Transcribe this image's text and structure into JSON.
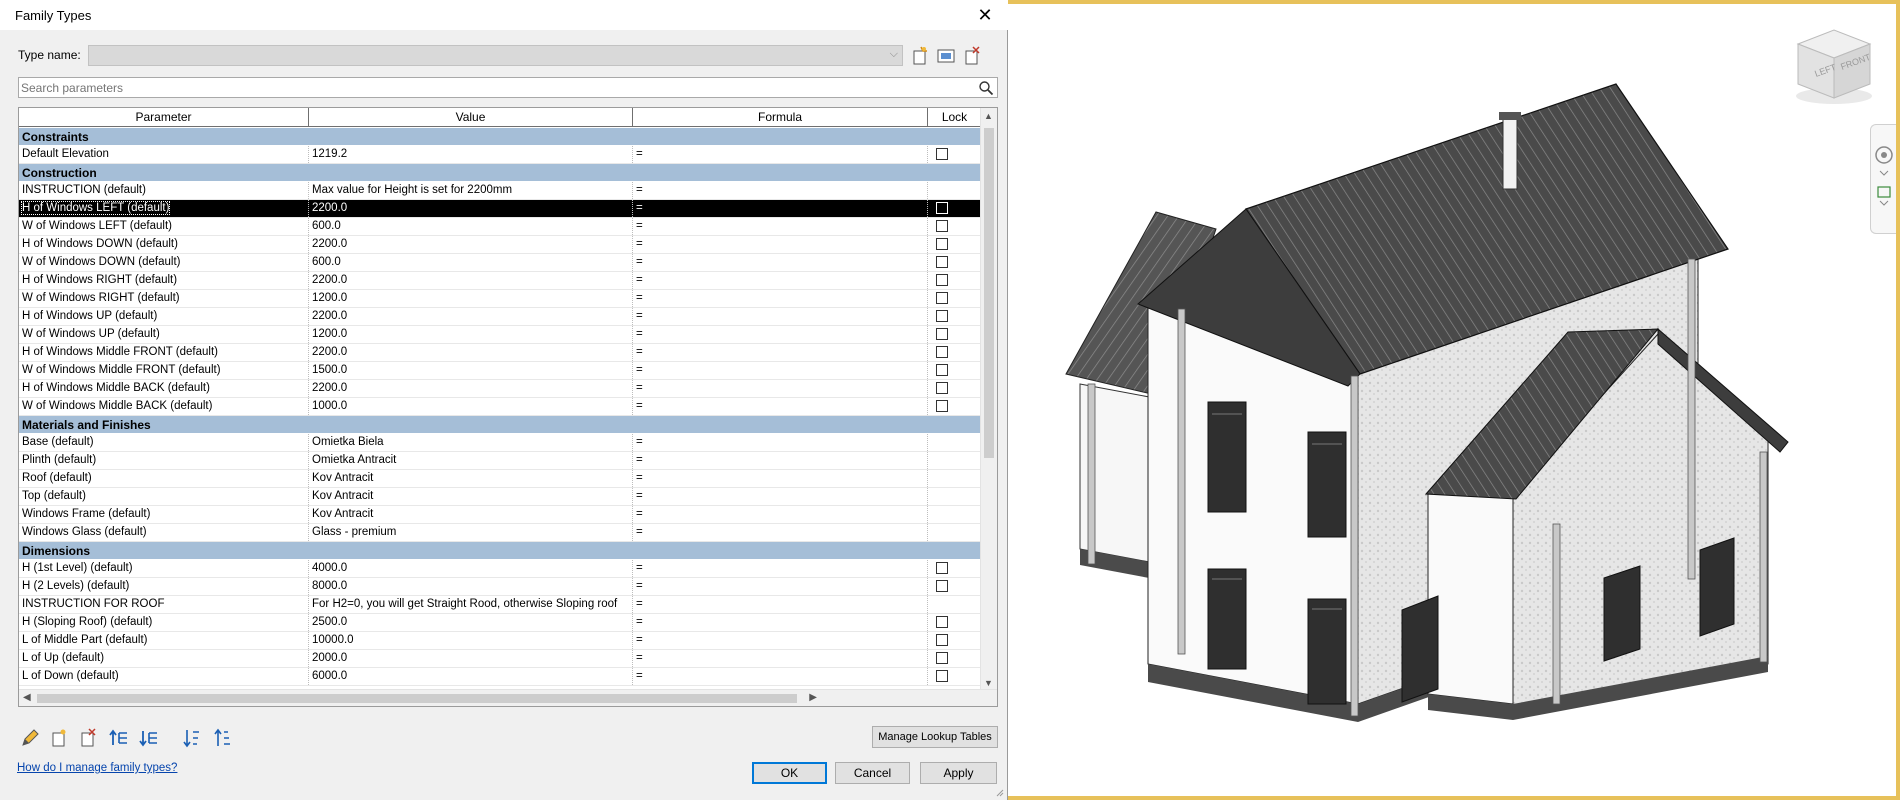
{
  "dialog": {
    "title": "Family Types",
    "type_name_label": "Type name:",
    "type_name_value": "",
    "search_placeholder": "Search parameters",
    "columns": [
      "Parameter",
      "Value",
      "Formula",
      "Lock"
    ],
    "groups": [
      {
        "name": "Constraints",
        "rows": [
          {
            "param": "Default Elevation",
            "value": "1219.2",
            "formula": "=",
            "lock": true
          }
        ]
      },
      {
        "name": "Construction",
        "rows": [
          {
            "param": "INSTRUCTION (default)",
            "value": "Max value for Height is set for 2200mm",
            "formula": "=",
            "lock": false
          },
          {
            "param": "H of Windows LEFT (default)",
            "value": "2200.0",
            "formula": "=",
            "lock": true,
            "selected": true
          },
          {
            "param": "W of Windows LEFT (default)",
            "value": "600.0",
            "formula": "=",
            "lock": true
          },
          {
            "param": "H of Windows DOWN (default)",
            "value": "2200.0",
            "formula": "=",
            "lock": true
          },
          {
            "param": "W of Windows DOWN (default)",
            "value": "600.0",
            "formula": "=",
            "lock": true
          },
          {
            "param": "H of Windows RIGHT (default)",
            "value": "2200.0",
            "formula": "=",
            "lock": true
          },
          {
            "param": "W of Windows RIGHT (default)",
            "value": "1200.0",
            "formula": "=",
            "lock": true
          },
          {
            "param": "H of Windows  UP (default)",
            "value": "2200.0",
            "formula": "=",
            "lock": true
          },
          {
            "param": "W of Windows UP (default)",
            "value": "1200.0",
            "formula": "=",
            "lock": true
          },
          {
            "param": "H of Windows Middle FRONT (default)",
            "value": "2200.0",
            "formula": "=",
            "lock": true
          },
          {
            "param": "W of Windows Middle FRONT (default)",
            "value": "1500.0",
            "formula": "=",
            "lock": true
          },
          {
            "param": "H of Windows Middle BACK (default)",
            "value": "2200.0",
            "formula": "=",
            "lock": true
          },
          {
            "param": "W of Windows Middle BACK (default)",
            "value": "1000.0",
            "formula": "=",
            "lock": true
          }
        ]
      },
      {
        "name": "Materials and Finishes",
        "rows": [
          {
            "param": "Base (default)",
            "value": "Omietka Biela",
            "formula": "=",
            "lock": false
          },
          {
            "param": "Plinth (default)",
            "value": "Omietka Antracit",
            "formula": "=",
            "lock": false
          },
          {
            "param": "Roof (default)",
            "value": "Kov Antracit",
            "formula": "=",
            "lock": false
          },
          {
            "param": "Top (default)",
            "value": "Kov Antracit",
            "formula": "=",
            "lock": false
          },
          {
            "param": "Windows Frame (default)",
            "value": "Kov Antracit",
            "formula": "=",
            "lock": false
          },
          {
            "param": "Windows Glass (default)",
            "value": "Glass - premium",
            "formula": "=",
            "lock": false
          }
        ]
      },
      {
        "name": "Dimensions",
        "rows": [
          {
            "param": "H (1st Level) (default)",
            "value": "4000.0",
            "formula": "=",
            "lock": true
          },
          {
            "param": "H (2 Levels) (default)",
            "value": "8000.0",
            "formula": "=",
            "lock": true
          },
          {
            "param": "INSTRUCTION FOR ROOF",
            "value": "For H2=0, you will get Straight Rood, otherwise Sloping roof",
            "formula": "=",
            "lock": false
          },
          {
            "param": "H (Sloping Roof) (default)",
            "value": "2500.0",
            "formula": "=",
            "lock": true
          },
          {
            "param": "L of Middle Part (default)",
            "value": "10000.0",
            "formula": "=",
            "lock": true
          },
          {
            "param": "L of Up (default)",
            "value": "2000.0",
            "formula": "=",
            "lock": true
          },
          {
            "param": "L of Down (default)",
            "value": "6000.0",
            "formula": "=",
            "lock": true
          }
        ]
      }
    ],
    "manage_lookup_label": "Manage Lookup Tables",
    "help_link": "How do I manage family types?",
    "ok_label": "OK",
    "cancel_label": "Cancel",
    "apply_label": "Apply"
  },
  "view": {
    "cube_left": "LEFT",
    "cube_front": "FRONT"
  },
  "colors": {
    "group_header": "#a5bed7",
    "selection": "#000000",
    "link": "#0645ad",
    "frame": "#e7c15a"
  }
}
